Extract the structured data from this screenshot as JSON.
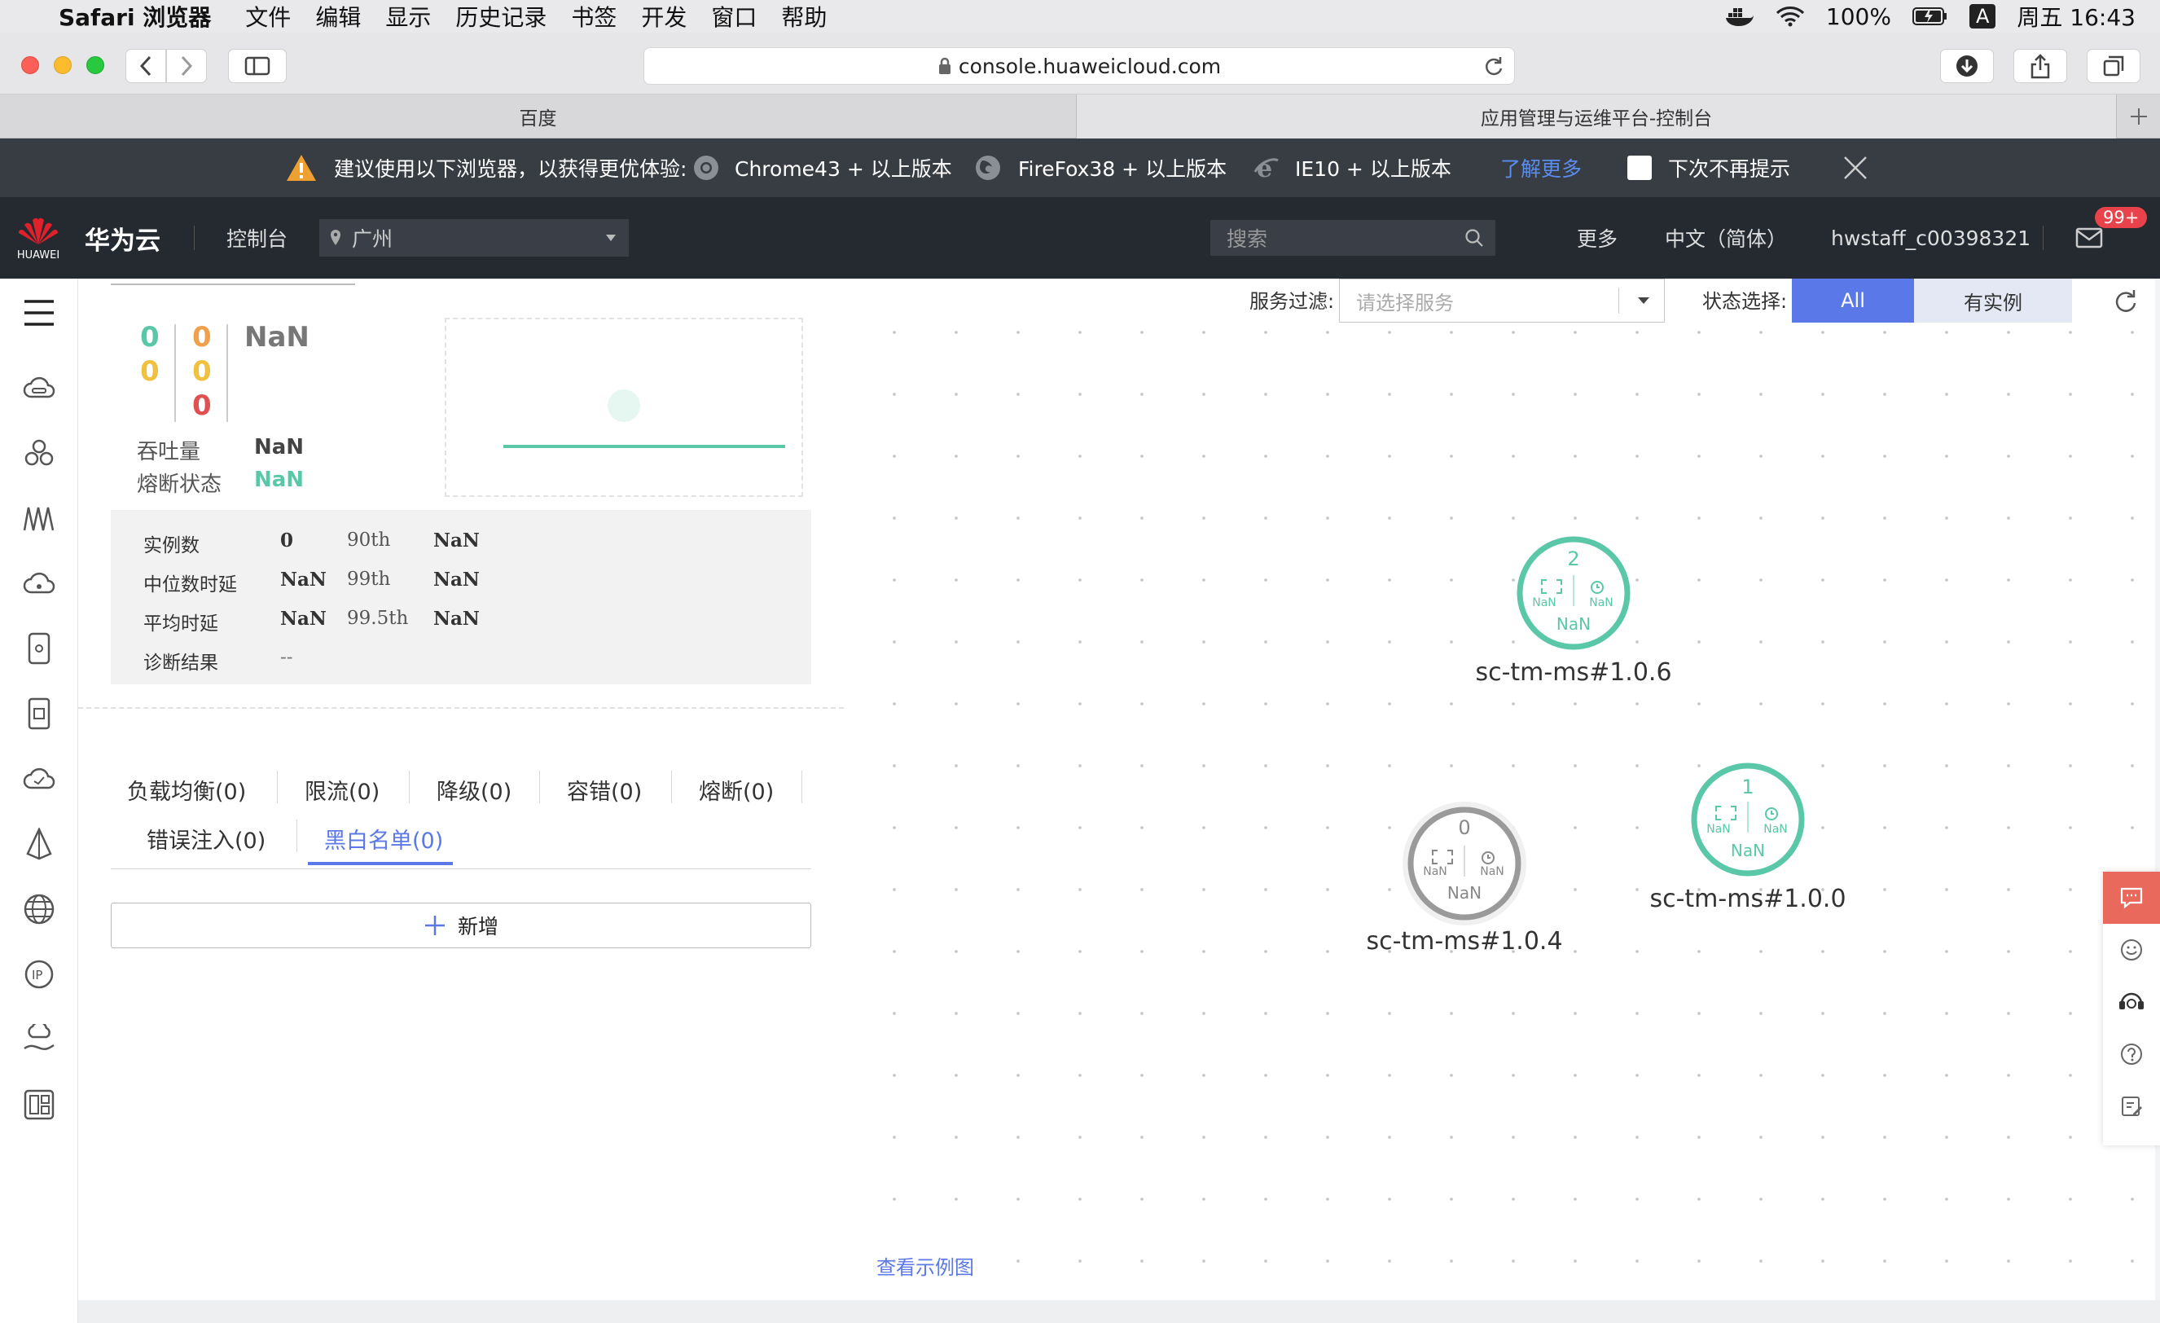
{
  "menubar": {
    "app": "Safari 浏览器",
    "items": [
      "文件",
      "编辑",
      "显示",
      "历史记录",
      "书签",
      "开发",
      "窗口",
      "帮助"
    ],
    "battery": "100%",
    "input_method": "A",
    "clock": "周五 16:43"
  },
  "browser": {
    "url": "console.huaweicloud.com",
    "tabs": [
      {
        "label": "百度",
        "active": false
      },
      {
        "label": "应用管理与运维平台-控制台",
        "active": true
      }
    ]
  },
  "warning": {
    "message": "建议使用以下浏览器，以获得更优体验:",
    "browsers": [
      "Chrome43 + 以上版本",
      "FireFox38 + 以上版本",
      "IE10 + 以上版本"
    ],
    "learn_more": "了解更多",
    "dont_show": "下次不再提示"
  },
  "header": {
    "brand": "华为云",
    "logo_text": "HUAWEI",
    "console": "控制台",
    "region": "广州",
    "search_placeholder": "搜索",
    "more": "更多",
    "language": "中文（简体）",
    "user": "hwstaff_c00398321",
    "badge": "99+"
  },
  "left_panel": {
    "counts": {
      "col1": [
        "0",
        "0"
      ],
      "col2": [
        "0",
        "0",
        "0"
      ],
      "main": "NaN"
    },
    "throughput_label": "吞吐量",
    "throughput_value": "NaN",
    "fuse_label": "熔断状态",
    "fuse_value": "NaN",
    "stats": [
      {
        "label": "实例数",
        "value": "0",
        "p_label": "90th",
        "p_value": "NaN"
      },
      {
        "label": "中位数时延",
        "value": "NaN",
        "p_label": "99th",
        "p_value": "NaN"
      },
      {
        "label": "平均时延",
        "value": "NaN",
        "p_label": "99.5th",
        "p_value": "NaN"
      },
      {
        "label": "诊断结果",
        "value": "--"
      }
    ],
    "tabs": [
      "负载均衡(0)",
      "限流(0)",
      "降级(0)",
      "容错(0)",
      "熔断(0)",
      "错误注入(0)",
      "黑白名单(0)"
    ],
    "active_tab": "黑白名单(0)",
    "add_button": "新增"
  },
  "graph": {
    "filter_label": "服务过滤:",
    "filter_placeholder": "请选择服务",
    "status_label": "状态选择:",
    "status_options": [
      "All",
      "有实例"
    ],
    "status_selected": "All",
    "nodes": [
      {
        "name": "sc-tm-ms#1.0.6",
        "count": "2",
        "left_metric": "NaN",
        "right_metric": "NaN",
        "bottom_metric": "NaN",
        "status": "active"
      },
      {
        "name": "sc-tm-ms#1.0.4",
        "count": "0",
        "left_metric": "NaN",
        "right_metric": "NaN",
        "bottom_metric": "NaN",
        "status": "inactive"
      },
      {
        "name": "sc-tm-ms#1.0.0",
        "count": "1",
        "left_metric": "NaN",
        "right_metric": "NaN",
        "bottom_metric": "NaN",
        "status": "active"
      }
    ],
    "legend_link": "查看示例图"
  },
  "colors": {
    "accent": "#5a78e8",
    "teal": "#5ac8a8",
    "orange": "#f0a04a",
    "red": "#e05050",
    "yellow": "#f0c040",
    "header_bg": "#252a31",
    "badge": "#e8434b"
  }
}
